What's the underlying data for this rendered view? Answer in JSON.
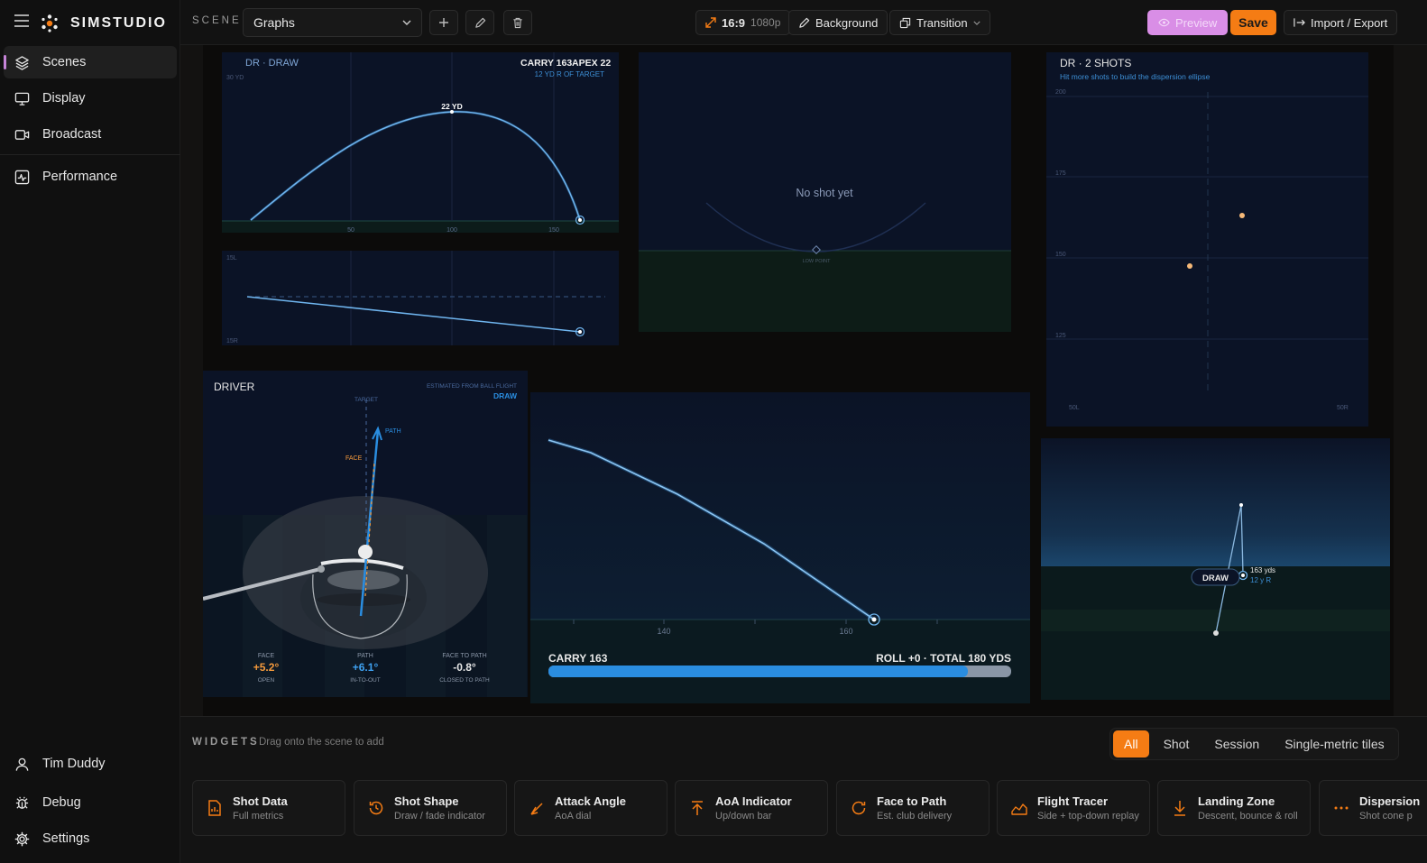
{
  "app": {
    "brand": "SIMSTUDIO"
  },
  "sidebar": {
    "items": [
      {
        "label": "Scenes"
      },
      {
        "label": "Display"
      },
      {
        "label": "Broadcast"
      },
      {
        "label": "Performance"
      }
    ],
    "bottom": [
      {
        "label": "Tim Duddy"
      },
      {
        "label": "Debug"
      },
      {
        "label": "Settings"
      }
    ]
  },
  "topbar": {
    "scene_label": "SCENE",
    "scene_value": "Graphs",
    "aspect": "16:9",
    "resolution": "1080p",
    "background_label": "Background",
    "transition_label": "Transition",
    "preview_label": "Preview",
    "save_label": "Save",
    "import_export_label": "Import / Export"
  },
  "scene": {
    "trajectory": {
      "title": "DR · DRAW",
      "carry": "CARRY 163",
      "apex": "APEX 22",
      "offline": "12 YD R OF TARGET",
      "y_tick": "30 YD",
      "apex_label": "22 YD",
      "x_ticks": [
        "50",
        "100",
        "150"
      ],
      "top_left": "15L",
      "top_right": "15R"
    },
    "lowpoint": {
      "message": "No shot yet",
      "label": "LOW POINT"
    },
    "dispersion": {
      "title": "DR · 2 SHOTS",
      "hint": "Hit more shots to build the dispersion ellipse",
      "y_ticks": [
        "200",
        "175",
        "150",
        "125"
      ],
      "x_left": "50L",
      "x_right": "50R"
    },
    "driver": {
      "title": "DRIVER",
      "est_label": "ESTIMATED FROM BALL FLIGHT",
      "shape": "DRAW",
      "target_label": "TARGET",
      "path_label": "PATH",
      "face_label": "FACE",
      "metrics": [
        {
          "label": "FACE",
          "value": "+5.2°",
          "sub": "OPEN"
        },
        {
          "label": "PATH",
          "value": "+6.1°",
          "sub": "IN-TO-OUT"
        },
        {
          "label": "FACE TO PATH",
          "value": "-0.8°",
          "sub": "CLOSED TO PATH"
        }
      ]
    },
    "descent": {
      "x_ticks": [
        "140",
        "160"
      ],
      "carry": "CARRY 163",
      "summary": "ROLL +0 · TOTAL 180 YDS",
      "carry_fraction": 0.906
    },
    "landing": {
      "badge": "DRAW",
      "yds": "163 yds",
      "offline": "12 y R"
    }
  },
  "widgets": {
    "heading": "WIDGETS",
    "hint": "Drag onto the scene to add",
    "filters": [
      {
        "label": "All"
      },
      {
        "label": "Shot"
      },
      {
        "label": "Session"
      },
      {
        "label": "Single-metric tiles"
      }
    ],
    "cards": [
      {
        "title": "Shot Data",
        "sub": "Full metrics",
        "icon": "document-icon"
      },
      {
        "title": "Shot Shape",
        "sub": "Draw / fade indicator",
        "icon": "history-icon"
      },
      {
        "title": "Attack Angle",
        "sub": "AoA dial",
        "icon": "angle-icon"
      },
      {
        "title": "AoA Indicator",
        "sub": "Up/down bar",
        "icon": "arrow-up-icon"
      },
      {
        "title": "Face to Path",
        "sub": "Est. club delivery",
        "icon": "rotate-icon"
      },
      {
        "title": "Flight Tracer",
        "sub": "Side + top-down replay",
        "icon": "area-chart-icon"
      },
      {
        "title": "Landing Zone",
        "sub": "Descent, bounce & roll",
        "icon": "arrow-down-icon"
      },
      {
        "title": "Dispersion",
        "sub": "Shot cone p",
        "icon": "dots-icon"
      }
    ]
  },
  "colors": {
    "accent": "#f57c14",
    "preview": "#d98ee6",
    "chart_blue": "#2a8de0",
    "face_orange": "#f59a3c"
  }
}
